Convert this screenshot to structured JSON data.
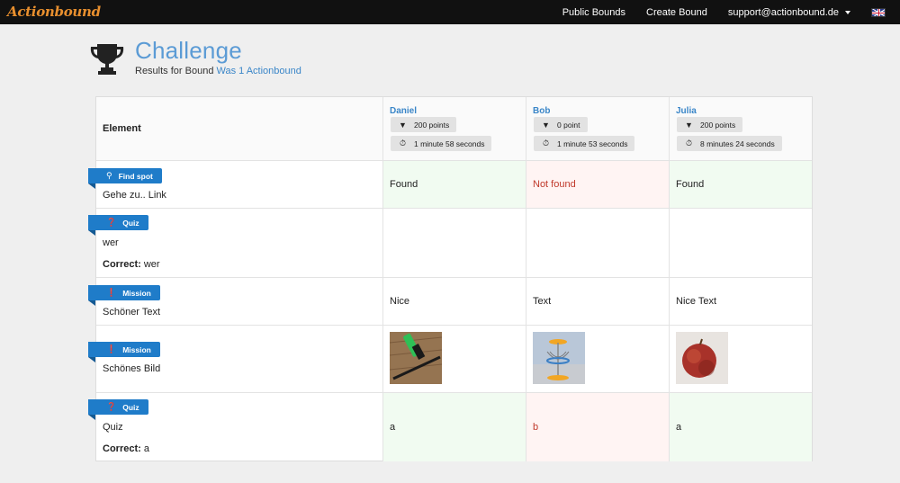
{
  "nav": {
    "brand": "Actionbound",
    "links": [
      "Public Bounds",
      "Create Bound"
    ],
    "user": "support@actionbound.de",
    "language_icon": "uk-flag-icon"
  },
  "header": {
    "title": "Challenge",
    "subtitle_prefix": "Results for Bound",
    "bound_name": "Was 1 Actionbound",
    "icon": "trophy-icon"
  },
  "table": {
    "element_header": "Element",
    "players": [
      {
        "name": "Daniel",
        "points": "200 points",
        "time": "1 minute 58 seconds"
      },
      {
        "name": "Bob",
        "points": "0 point",
        "time": "1 minute 53 seconds"
      },
      {
        "name": "Julia",
        "points": "200 points",
        "time": "8 minutes 24 seconds"
      }
    ],
    "rows": [
      {
        "type": "Find spot",
        "icon": "map-marker-icon",
        "title": "Gehe zu.. Link",
        "correct": null,
        "answers": [
          "Found",
          "Not found",
          "Found"
        ],
        "status": [
          "right",
          "wrong",
          "right"
        ]
      },
      {
        "type": "Quiz",
        "icon": "question-circle-icon",
        "title": "wer",
        "correct_label": "Correct:",
        "correct": "wer",
        "answers": [
          "",
          "",
          ""
        ],
        "status": [
          "none",
          "none",
          "none"
        ]
      },
      {
        "type": "Mission",
        "icon": "exclamation-circle-icon",
        "title": "Schöner Text",
        "correct": null,
        "answers": [
          "Nice",
          "Text",
          "Nice Text"
        ],
        "status": [
          "none",
          "none",
          "none"
        ]
      },
      {
        "type": "Mission",
        "icon": "exclamation-circle-icon",
        "title": "Schönes Bild",
        "correct": null,
        "answers": [
          "marker-photo",
          "basket-photo",
          "apple-photo"
        ],
        "status": [
          "none",
          "none",
          "none"
        ]
      },
      {
        "type": "Quiz",
        "icon": "question-circle-icon",
        "title": "Quiz",
        "correct_label": "Correct:",
        "correct": "a",
        "answers": [
          "a",
          "b",
          "a"
        ],
        "status": [
          "right",
          "wrong",
          "right"
        ]
      }
    ]
  },
  "colors": {
    "accent": "#3a86c8",
    "tag": "#1f7cc9",
    "brand": "#e88f2e",
    "correct_bg": "#f1fbf1",
    "wrong_bg": "#fff4f3",
    "wrong_text": "#c0392b"
  }
}
